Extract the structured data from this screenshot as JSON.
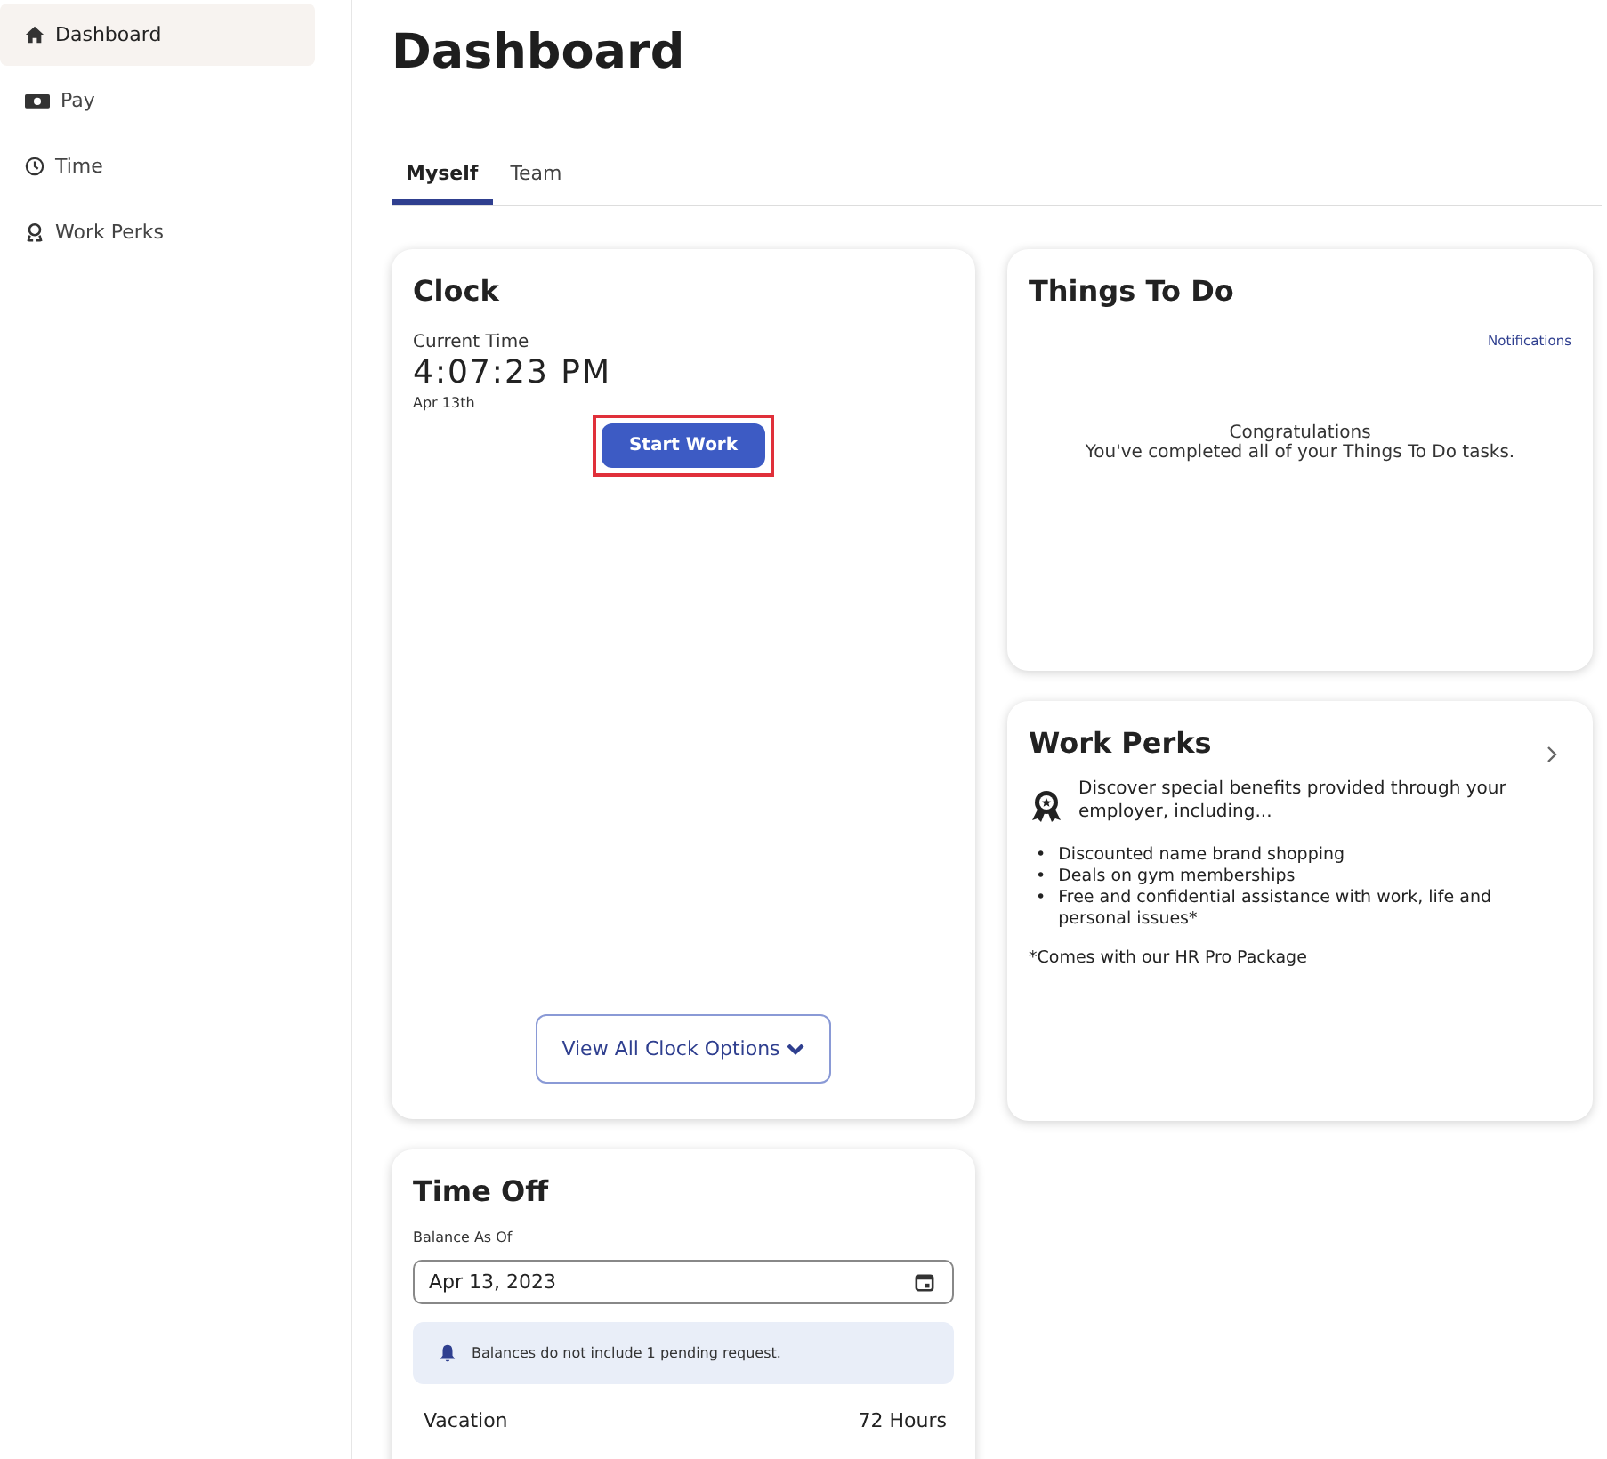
{
  "sidebar": {
    "items": [
      {
        "label": "Dashboard",
        "selected": true
      },
      {
        "label": "Pay",
        "selected": false
      },
      {
        "label": "Time",
        "selected": false
      },
      {
        "label": "Work Perks",
        "selected": false
      }
    ]
  },
  "page_title": "Dashboard",
  "tabs": [
    {
      "label": "Myself",
      "selected": true
    },
    {
      "label": "Team",
      "selected": false
    }
  ],
  "clock": {
    "title": "Clock",
    "current_time_label": "Current Time",
    "time": "4:07:23 PM",
    "date": "Apr 13th",
    "start_button": {
      "label": "Start Work",
      "highlighted": true
    },
    "options_button": "View All Clock Options"
  },
  "things_to_do": {
    "title": "Things To Do",
    "link": "Notifications",
    "message_title": "Congratulations",
    "message": "You've completed all of your Things To Do tasks."
  },
  "work_perks": {
    "title": "Work Perks",
    "intro": "Discover special benefits provided through your employer, including...",
    "bullets": [
      {
        "marker": "•",
        "text": "Discounted name brand shopping"
      },
      {
        "marker": "•",
        "text": "Deals on gym memberships"
      },
      {
        "marker": "•",
        "text": "Free and confidential assistance with work, life and personal issues*"
      }
    ],
    "footnote": "*Comes with our HR Pro Package"
  },
  "time_off": {
    "title": "Time Off",
    "balance_label": "Balance As Of",
    "date_value": "Apr 13, 2023",
    "notice": "Balances do not include 1 pending request.",
    "rows": [
      {
        "name": "Vacation",
        "amount": "72 Hours"
      }
    ]
  }
}
